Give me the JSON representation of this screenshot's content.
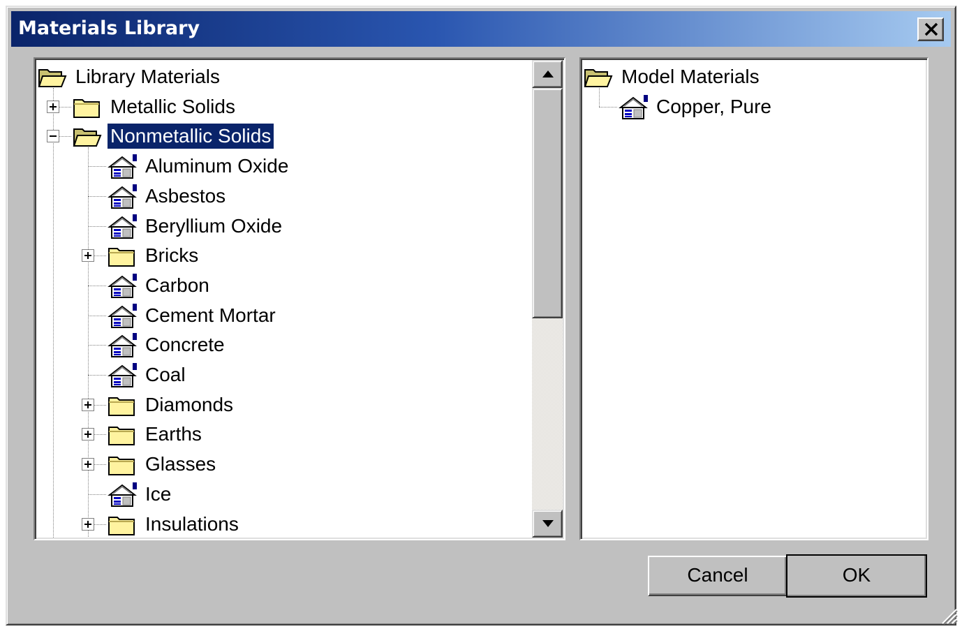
{
  "window": {
    "title": "Materials Library"
  },
  "library_tree": {
    "root": "Library Materials",
    "nodes": [
      {
        "label": "Metallic Solids",
        "type": "folder",
        "level": 1,
        "expander": "plus",
        "selected": false
      },
      {
        "label": "Nonmetallic Solids",
        "type": "folder-open",
        "level": 1,
        "expander": "minus",
        "selected": true
      },
      {
        "label": "Aluminum Oxide",
        "type": "material",
        "level": 2
      },
      {
        "label": "Asbestos",
        "type": "material",
        "level": 2
      },
      {
        "label": "Beryllium Oxide",
        "type": "material",
        "level": 2
      },
      {
        "label": "Bricks",
        "type": "folder",
        "level": 2,
        "expander": "plus"
      },
      {
        "label": "Carbon",
        "type": "material",
        "level": 2
      },
      {
        "label": "Cement Mortar",
        "type": "material",
        "level": 2
      },
      {
        "label": "Concrete",
        "type": "material",
        "level": 2
      },
      {
        "label": "Coal",
        "type": "material",
        "level": 2
      },
      {
        "label": "Diamonds",
        "type": "folder",
        "level": 2,
        "expander": "plus"
      },
      {
        "label": "Earths",
        "type": "folder",
        "level": 2,
        "expander": "plus"
      },
      {
        "label": "Glasses",
        "type": "folder",
        "level": 2,
        "expander": "plus"
      },
      {
        "label": "Ice",
        "type": "material",
        "level": 2
      },
      {
        "label": "Insulations",
        "type": "folder",
        "level": 2,
        "expander": "plus"
      }
    ]
  },
  "model_tree": {
    "root": "Model Materials",
    "nodes": [
      {
        "label": "Copper, Pure",
        "type": "material",
        "level": 1
      }
    ]
  },
  "buttons": {
    "cancel": "Cancel",
    "ok": "OK"
  },
  "icons": {
    "close": "close-icon",
    "folder": "folder-icon",
    "folder_open": "folder-open-icon",
    "material": "material-icon",
    "scroll_up": "arrow-up-icon",
    "scroll_down": "arrow-down-icon",
    "resize_grip": "resize-grip-icon"
  },
  "colors": {
    "selection": "#0a246a",
    "titlebar_start": "#0a246a",
    "titlebar_end": "#a6caf0",
    "face": "#c0c0c0"
  }
}
